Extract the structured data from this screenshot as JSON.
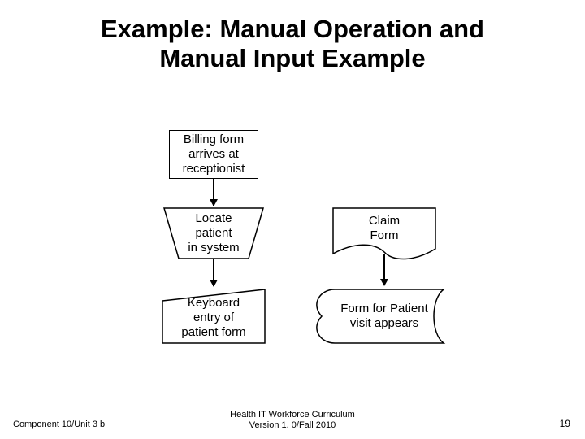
{
  "title_line1": "Example: Manual Operation and",
  "title_line2": "Manual Input Example",
  "nodes": {
    "billing": "Billing form\narrives at\nreceptionist",
    "locate": "Locate\npatient\nin system",
    "keyboard": "Keyboard\nentry of\npatient form",
    "claim": "Claim\nForm",
    "display": "Form for Patient\nvisit appears"
  },
  "footer": {
    "left": "Component 10/Unit 3 b",
    "center_line1": "Health IT Workforce Curriculum",
    "center_line2": "Version 1. 0/Fall 2010",
    "right": "19"
  }
}
